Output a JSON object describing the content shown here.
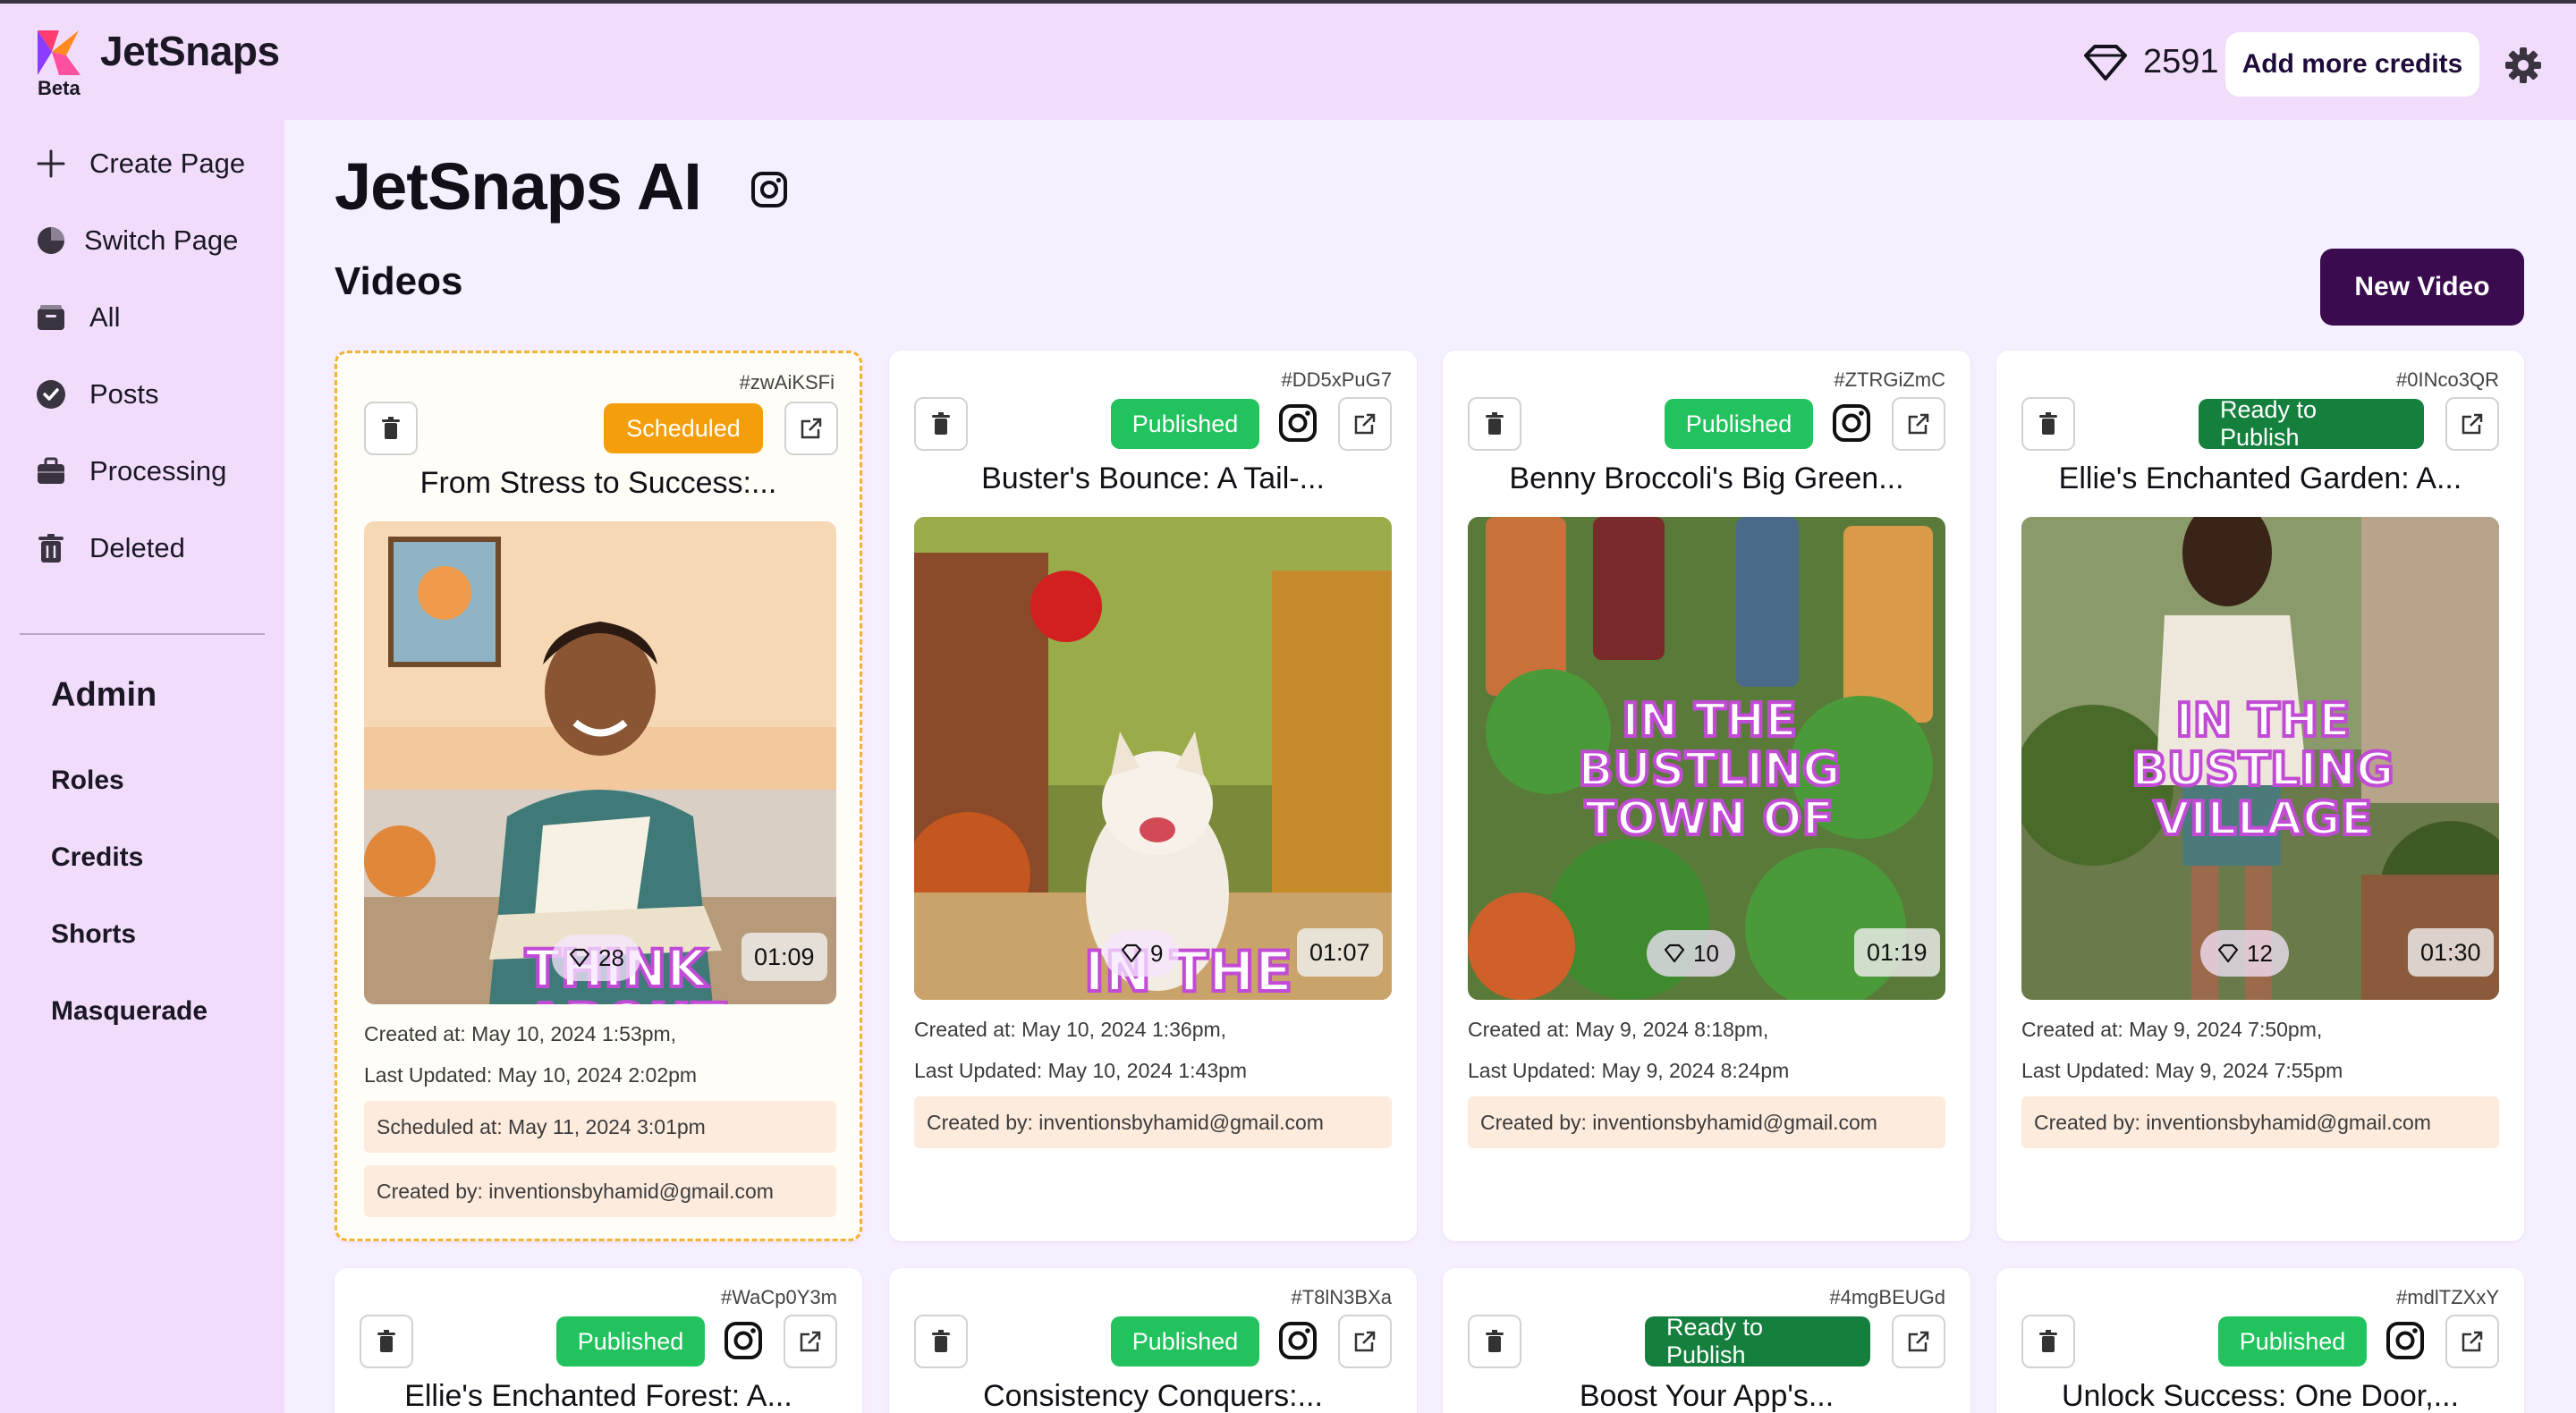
{
  "header": {
    "brand": "JetSnaps",
    "beta": "Beta",
    "credits": "2591",
    "add_credits_label": "Add more credits"
  },
  "sidebar": {
    "items": [
      {
        "label": "Create Page",
        "icon": "plus-icon"
      },
      {
        "label": "Switch Page",
        "icon": "pie-chart-icon"
      },
      {
        "label": "All",
        "icon": "inbox-icon"
      },
      {
        "label": "Posts",
        "icon": "check-badge-icon"
      },
      {
        "label": "Processing",
        "icon": "briefcase-icon"
      },
      {
        "label": "Deleted",
        "icon": "trash-icon"
      }
    ],
    "admin_title": "Admin",
    "admin_links": [
      "Roles",
      "Credits",
      "Shorts",
      "Masquerade"
    ]
  },
  "main": {
    "page_title": "JetSnaps AI",
    "section_title": "Videos",
    "new_video_label": "New Video"
  },
  "colors": {
    "accent": "#3a0c4f",
    "published": "#22c35e",
    "ready": "#15803d",
    "scheduled": "#f59e0b",
    "info_bg": "#fdebdd"
  },
  "cards": [
    {
      "id": "#zwAiKSFi",
      "status": "Scheduled",
      "title": "From Stress to Success:...",
      "credits": "28",
      "duration": "01:09",
      "created": "Created at: May 10, 2024 1:53pm,",
      "updated": "Last Updated: May 10, 2024 2:02pm",
      "scheduled": "Scheduled at: May 11, 2024 3:01pm",
      "created_by": "Created by: inventionsbyhamid@gmail.com",
      "overlay": [
        "THINK",
        "ABOUT"
      ]
    },
    {
      "id": "#DD5xPuG7",
      "status": "Published",
      "title": "Buster's Bounce: A Tail-...",
      "credits": "9",
      "duration": "01:07",
      "created": "Created at: May 10, 2024 1:36pm,",
      "updated": "Last Updated: May 10, 2024 1:43pm",
      "created_by": "Created by: inventionsbyhamid@gmail.com",
      "overlay": [
        "IN THE"
      ]
    },
    {
      "id": "#ZTRGiZmC",
      "status": "Published",
      "title": "Benny Broccoli's Big Green...",
      "credits": "10",
      "duration": "01:19",
      "created": "Created at: May 9, 2024 8:18pm,",
      "updated": "Last Updated: May 9, 2024 8:24pm",
      "created_by": "Created by: inventionsbyhamid@gmail.com",
      "overlay": [
        "IN THE",
        "BUSTLING",
        "TOWN OF"
      ]
    },
    {
      "id": "#0INco3QR",
      "status": "Ready to Publish",
      "title": "Ellie's Enchanted Garden: A...",
      "credits": "12",
      "duration": "01:30",
      "created": "Created at: May 9, 2024 7:50pm,",
      "updated": "Last Updated: May 9, 2024 7:55pm",
      "created_by": "Created by: inventionsbyhamid@gmail.com",
      "overlay": [
        "IN THE",
        "BUSTLING",
        "VILLAGE"
      ]
    },
    {
      "id": "#WaCp0Y3m",
      "status": "Published",
      "title": "Ellie's Enchanted Forest: A..."
    },
    {
      "id": "#T8lN3BXa",
      "status": "Published",
      "title": "Consistency Conquers:..."
    },
    {
      "id": "#4mgBEUGd",
      "status": "Ready to Publish",
      "title": "Boost Your App's..."
    },
    {
      "id": "#mdlTZXxY",
      "status": "Published",
      "title": "Unlock Success: One Door,..."
    }
  ]
}
